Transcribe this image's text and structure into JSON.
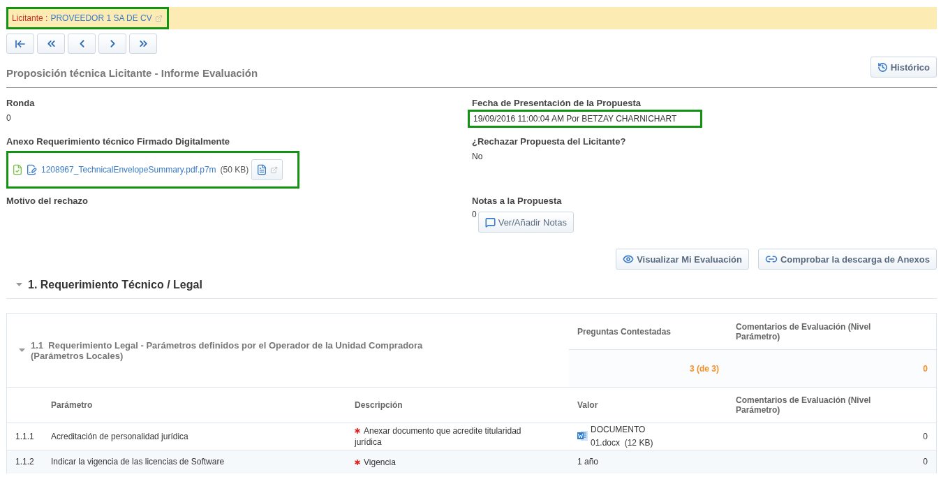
{
  "bidder": {
    "label": "Licitante :",
    "name": "PROVEEDOR 1 SA DE CV",
    "highlighted": true
  },
  "nav_buttons": [
    {
      "kind": "first"
    },
    {
      "kind": "fast-back"
    },
    {
      "kind": "back"
    },
    {
      "kind": "forward"
    },
    {
      "kind": "fast-forward"
    }
  ],
  "title": "Proposición técnica Licitante - Informe Evaluación",
  "history_button": "Histórico",
  "round": {
    "label": "Ronda",
    "value": "0"
  },
  "annex": {
    "label": "Anexo Requerimiento técnico Firmado Digitalmente",
    "file": "1208967_TechnicalEnvelopeSummary.pdf.p7m",
    "size": "(50 KB)",
    "highlighted": true
  },
  "rejection_reason": {
    "label": "Motivo del rechazo"
  },
  "submission": {
    "label": "Fecha de Presentación de la Propuesta",
    "value": "19/09/2016 11:00:04 AM Por BETZAY CHARNICHART",
    "highlighted": true
  },
  "reject": {
    "label": "¿Rechazar Propuesta del Licitante?",
    "value": "No"
  },
  "notes": {
    "label": "Notas a la Propuesta",
    "count": "0",
    "button": "Ver/Añadir Notas"
  },
  "actions": [
    {
      "kind": "view",
      "label": "Visualizar Mi Evaluación"
    },
    {
      "kind": "check",
      "label": "Comprobar la descarga de Anexos"
    }
  ],
  "section": {
    "title": "1. Requerimiento Técnico / Legal",
    "expanded": true
  },
  "subsection": {
    "number": "1.1",
    "title": "Requerimiento Legal - Parámetros definidos por el Operador de la Unidad Compradora (Parámetros Locales)",
    "expanded": true,
    "summary_columns": [
      "Preguntas Contestadas",
      "Comentarios de Evaluación (Nivel Parámetro)"
    ],
    "answered": "3 (de 3)",
    "comments": "0"
  },
  "table": {
    "columns": [
      "Parámetro",
      "Descripción",
      "Valor",
      "Comentarios de Evaluación (Nivel Parámetro)"
    ],
    "rows": [
      {
        "number": "1.1.1",
        "parameter": "Acreditación de personalidad jurídica",
        "description": "Anexar documento que acredite titularidad jurídica",
        "required": true,
        "kind": "file",
        "value": "DOCUMENTO 01.docx",
        "value_size": "(12 KB)",
        "comments": "0"
      },
      {
        "number": "1.1.2",
        "parameter": "Indicar la vigencia de las licencias de Software",
        "description": "Vigencia",
        "required": true,
        "kind": "text",
        "value": "1 año",
        "comments": "0"
      }
    ]
  }
}
